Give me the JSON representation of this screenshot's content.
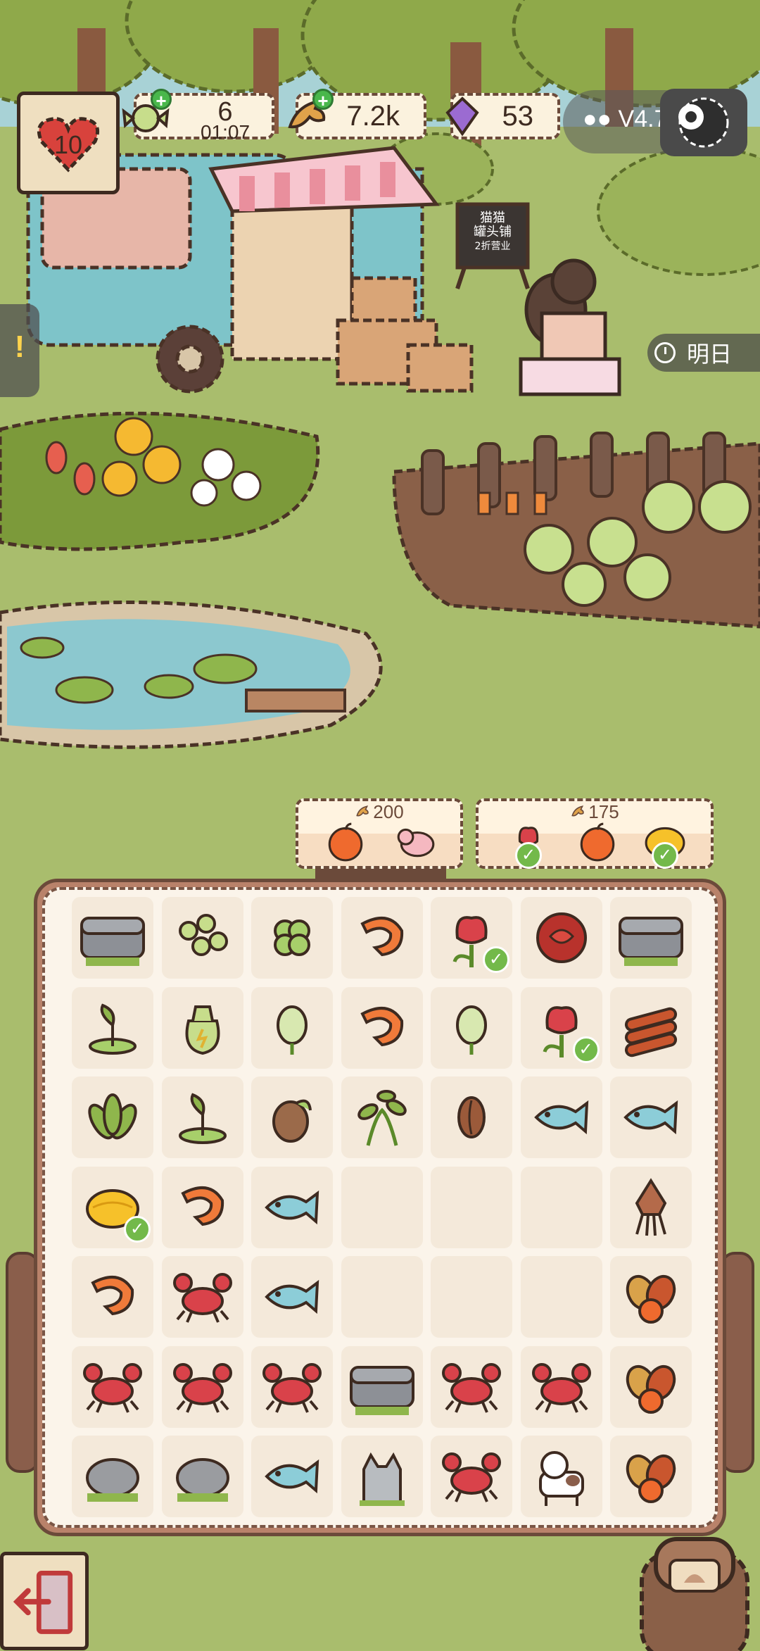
{
  "hud": {
    "lives": "10",
    "energy": "6",
    "energy_timer": "01:07",
    "fish_coins": "7.2k",
    "gems": "53",
    "version": "V4.7"
  },
  "shop": {
    "sign_line1": "猫猫",
    "sign_line2": "罐头铺",
    "sign_line3": "2折营业"
  },
  "side": {
    "left_tab": "!",
    "timer_label": "明日"
  },
  "orders": [
    {
      "price": "200",
      "items": [
        "apple",
        "pig"
      ]
    },
    {
      "price": "175",
      "items": [
        "tulip",
        "apple",
        "mango"
      ]
    }
  ],
  "inventory": {
    "rows": [
      [
        "chest",
        "seeds",
        "clover",
        "shrimp",
        "tulip",
        "rose",
        "chest"
      ],
      [
        "sprout",
        "bag",
        "bud",
        "shrimp",
        "bud",
        "tulip",
        "wheat"
      ],
      [
        "leaves",
        "sprout",
        "seed",
        "plant",
        "bean",
        "fish",
        "fish"
      ],
      [
        "mango",
        "shrimp",
        "fish",
        "",
        "",
        "",
        "squid"
      ],
      [
        "shrimp",
        "crab",
        "fish",
        "",
        "",
        "",
        "fruit"
      ],
      [
        "crab",
        "crab",
        "crab",
        "chest",
        "crab",
        "crab",
        "fruit"
      ],
      [
        "stone",
        "stone",
        "fish",
        "cat",
        "crab",
        "cow",
        "fruit"
      ]
    ],
    "checked": [
      "0-4",
      "1-5",
      "3-0"
    ]
  },
  "colors": {
    "grass": "#a9bd6d",
    "board": "#fbf4ea",
    "cell": "#f4e9da",
    "outline": "#6b4a3a",
    "check": "#73b94a"
  }
}
